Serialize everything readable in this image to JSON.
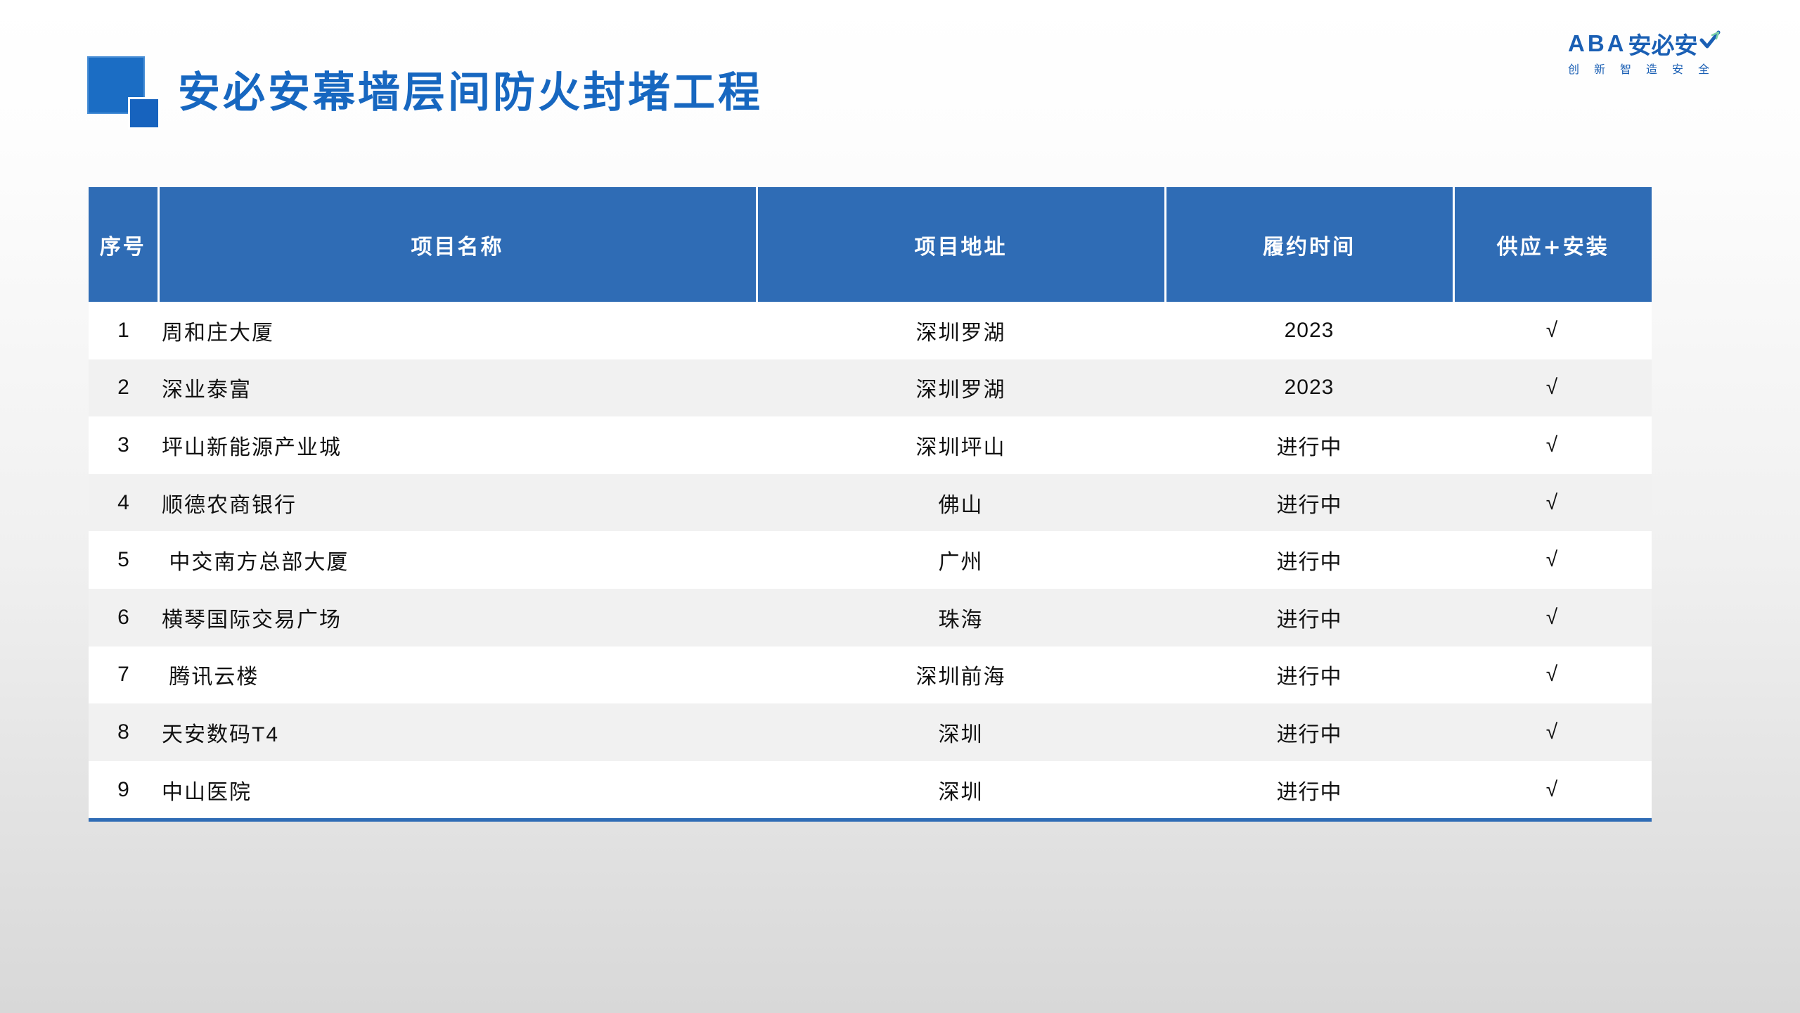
{
  "title": "安必安幕墙层间防火封堵工程",
  "logo": {
    "brand_latin": "ABA",
    "brand_cn": "安必安",
    "tagline": "创新智造安全",
    "icon": "checkmark-icon"
  },
  "colors": {
    "accent": "#2f6cb5",
    "title": "#1767c0"
  },
  "table": {
    "headers": [
      "序号",
      "项目名称",
      "项目地址",
      "履约时间",
      "供应+安装"
    ],
    "rows": [
      {
        "no": "1",
        "name": "周和庄大厦",
        "address": "深圳罗湖",
        "time": "2023",
        "supply_install": "√"
      },
      {
        "no": "2",
        "name": "深业泰富",
        "address": "深圳罗湖",
        "time": "2023",
        "supply_install": "√"
      },
      {
        "no": "3",
        "name": "坪山新能源产业城",
        "address": "深圳坪山",
        "time": "进行中",
        "supply_install": "√"
      },
      {
        "no": "4",
        "name": "顺德农商银行",
        "address": "佛山",
        "time": "进行中",
        "supply_install": "√"
      },
      {
        "no": "5",
        "name": " 中交南方总部大厦",
        "address": "广州",
        "time": "进行中",
        "supply_install": "√"
      },
      {
        "no": "6",
        "name": "横琴国际交易广场",
        "address": "珠海",
        "time": "进行中",
        "supply_install": "√"
      },
      {
        "no": "7",
        "name": " 腾讯云楼",
        "address": "深圳前海",
        "time": "进行中",
        "supply_install": "√"
      },
      {
        "no": "8",
        "name": "天安数码T4",
        "address": "深圳",
        "time": "进行中",
        "supply_install": "√"
      },
      {
        "no": "9",
        "name": "中山医院",
        "address": "深圳",
        "time": "进行中",
        "supply_install": "√"
      }
    ]
  }
}
